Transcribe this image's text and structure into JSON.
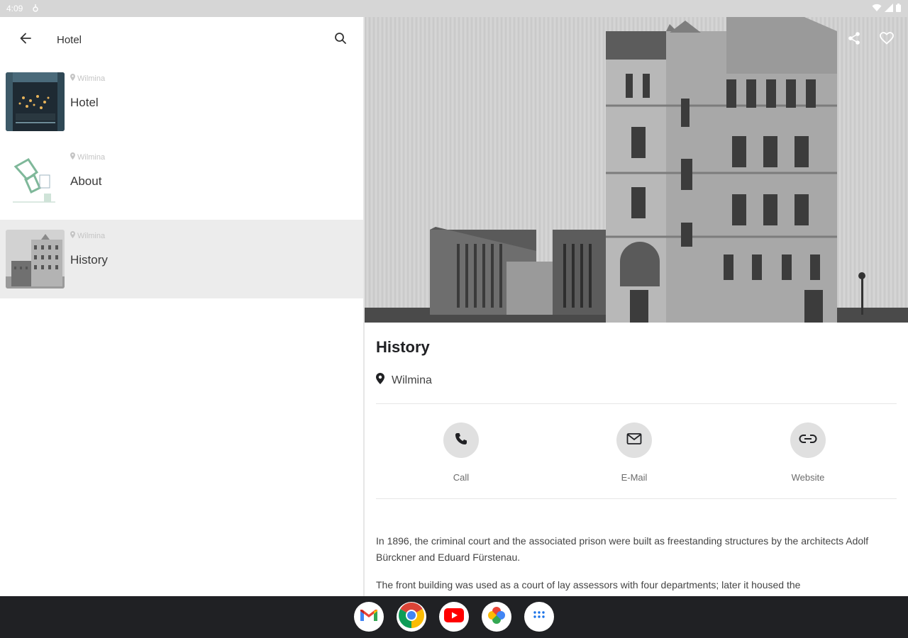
{
  "status_bar": {
    "time": "4:09"
  },
  "search_bar": {
    "query": "Hotel"
  },
  "list": [
    {
      "location": "Wilmina",
      "title": "Hotel"
    },
    {
      "location": "Wilmina",
      "title": "About"
    },
    {
      "location": "Wilmina",
      "title": "History"
    }
  ],
  "detail": {
    "title": "History",
    "location": "Wilmina",
    "actions": {
      "call": "Call",
      "email": "E-Mail",
      "website": "Website"
    },
    "paragraphs": [
      "In 1896, the criminal court and the associated prison were built as freestanding structures by the architects Adolf Bürckner and Eduard Fürstenau.",
      "The front building was used as a court of lay assessors with four departments; later it housed the"
    ]
  },
  "dock": {
    "apps": [
      "gmail-icon",
      "chrome-icon",
      "youtube-icon",
      "photos-icon",
      "app-drawer-icon"
    ]
  },
  "colors": {
    "status_bar": "#d6d6d6",
    "selected_row": "#ececec",
    "nav_bar": "#202124",
    "action_circle": "#e0e0e0"
  }
}
